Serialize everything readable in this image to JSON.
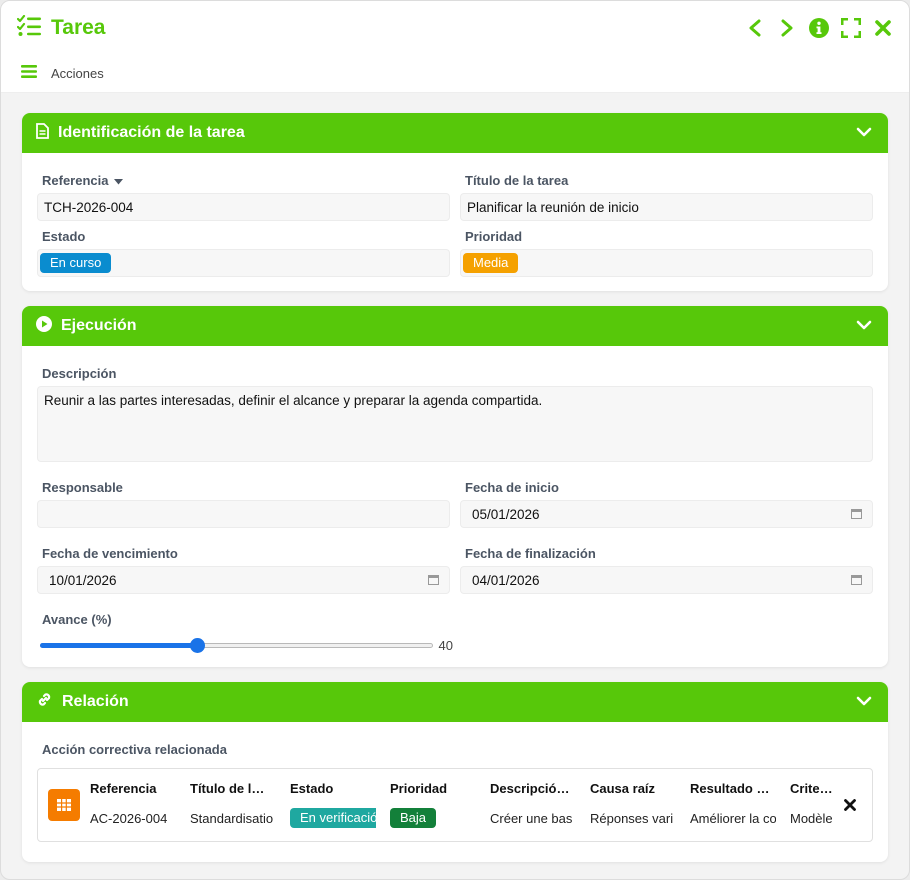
{
  "window": {
    "title": "Tarea"
  },
  "toolbar": {
    "actions_label": "Acciones"
  },
  "colors": {
    "accent": "#57c80a",
    "status_en_curso": "#0a8ccf",
    "priority_media": "#f5a100",
    "status_verificacion": "#1fa8a0",
    "priority_baja": "#13803a",
    "slider": "#1a73e8",
    "related_icon": "#f57c00"
  },
  "identificacion": {
    "title": "Identificación de la tarea",
    "referencia_label": "Referencia",
    "referencia_value": "TCH-2026-004",
    "titulo_label": "Título de la tarea",
    "titulo_value": "Planificar la reunión de inicio",
    "estado_label": "Estado",
    "estado_value": "En curso",
    "prioridad_label": "Prioridad",
    "prioridad_value": "Media"
  },
  "ejecucion": {
    "title": "Ejecución",
    "descripcion_label": "Descripción",
    "descripcion_value": "Reunir a las partes interesadas, definir el alcance y preparar la agenda compartida.",
    "responsable_label": "Responsable",
    "responsable_value": "",
    "fecha_inicio_label": "Fecha de inicio",
    "fecha_inicio_value": "05/01/2026",
    "fecha_vencimiento_label": "Fecha de vencimiento",
    "fecha_vencimiento_value": "10/01/2026",
    "fecha_finalizacion_label": "Fecha de finalización",
    "fecha_finalizacion_value": "04/01/2026",
    "avance_label": "Avance (%)",
    "avance_value": 40,
    "avance_display": "40"
  },
  "relacion": {
    "title": "Relación",
    "accion_label": "Acción correctiva relacionada",
    "columns": [
      {
        "header": "Referencia",
        "value": "AC-2026-004"
      },
      {
        "header": "Título de l…",
        "value": "Standardisatio"
      },
      {
        "header": "Estado",
        "value": "En verificación",
        "badge": true,
        "color": "#1fa8a0"
      },
      {
        "header": "Prioridad",
        "value": "Baja",
        "badge": true,
        "color": "#13803a"
      },
      {
        "header": "Descripció…",
        "value": "Créer une bas"
      },
      {
        "header": "Causa raíz",
        "value": "Réponses vari"
      },
      {
        "header": "Resultado …",
        "value": "Améliorer la co"
      },
      {
        "header": "Criterio",
        "value": "Modèle"
      }
    ]
  }
}
